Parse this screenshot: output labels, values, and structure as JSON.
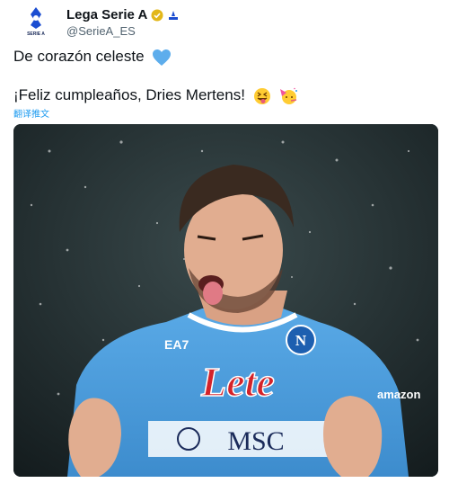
{
  "account": {
    "display_name": "Lega Serie A",
    "handle": "@SerieA_ES",
    "logo_text": "SERIE A"
  },
  "tweet": {
    "line1": "De corazón celeste",
    "line2": "¡Feliz cumpleaños, Dries Mertens!",
    "translate_label": "翻译推文"
  },
  "media": {
    "jersey_sponsor": "Lete",
    "jersey_brand": "EA7",
    "sleeve_sponsor": "MSC",
    "side_logo": "amazon",
    "crest_letter": "N"
  },
  "icons": {
    "verified": "verified-badge-icon",
    "blue_heart": "blue-heart-icon",
    "tongue_emoji": "squinting-tongue-face-icon",
    "party_emoji": "party-face-icon"
  },
  "colors": {
    "link": "#1d9bf0",
    "handle": "#536471",
    "jersey": "#4a9bdc",
    "sponsor_red": "#d3232a"
  }
}
